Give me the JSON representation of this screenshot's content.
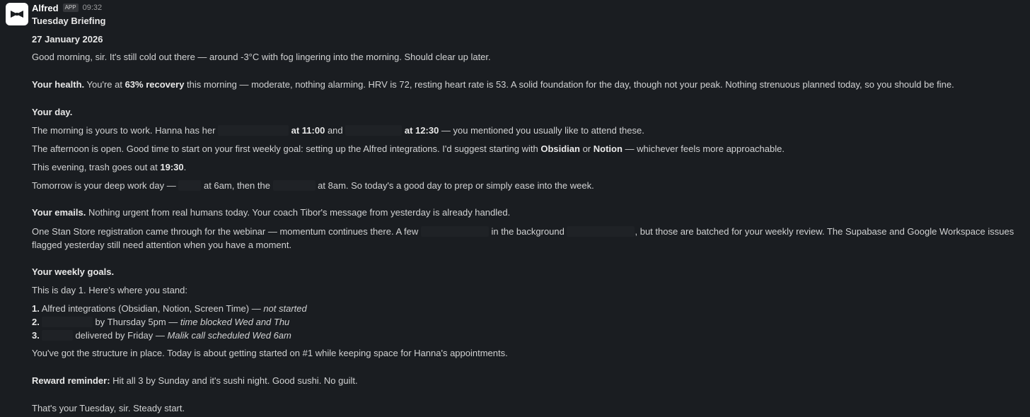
{
  "message": {
    "sender": "Alfred",
    "badge": "APP",
    "time": "09:32",
    "title": "Tuesday Briefing",
    "date": "27 January 2026",
    "greeting": "Good morning, sir. It's still cold out there — around -3°C with fog lingering into the morning. Should clear up later.",
    "health": {
      "label": "Your health.",
      "pre": " You're at ",
      "recovery": "63% recovery",
      "post": " this morning — moderate, nothing alarming. HRV is 72, resting heart rate is 53. A solid foundation for the day, though not your peak. Nothing strenuous planned today, so you should be fine."
    },
    "day": {
      "label": "Your day.",
      "l1_a": "The morning is yours to work. Hanna has her ",
      "l1_t1": " at 11:00",
      "l1_and": " and ",
      "l1_t2": " at 12:30",
      "l1_b": " — you mentioned you usually like to attend these.",
      "l2_a": "The afternoon is open. Good time to start on your first weekly goal: setting up the Alfred integrations. I'd suggest starting with ",
      "l2_obsidian": "Obsidian",
      "l2_or": " or ",
      "l2_notion": "Notion",
      "l2_b": " — whichever feels more approachable.",
      "l3_a": "This evening, trash goes out at ",
      "l3_time": "19:30",
      "l3_b": ".",
      "l4_a": "Tomorrow is your deep work day — ",
      "l4_b": " at 6am, then the ",
      "l4_c": " at 8am. So today's a good day to prep or simply ease into the week."
    },
    "emails": {
      "label": "Your emails.",
      "l1": " Nothing urgent from real humans today. Your coach Tibor's message from yesterday is already handled.",
      "l2_a": "One Stan Store registration came through for the webinar — momentum continues there. A few ",
      "l2_b": " in the background ",
      "l2_c": ", but those are batched for your weekly review. The Supabase and Google Workspace issues flagged yesterday still need attention when you have a moment."
    },
    "goals": {
      "label": "Your weekly goals.",
      "intro": "This is day 1. Here's where you stand:",
      "g1_num": "1.",
      "g1_text": " Alfred integrations (Obsidian, Notion, Screen Time) — ",
      "g1_status": "not started",
      "g2_num": "2.",
      "g2_text": " by Thursday 5pm — ",
      "g2_status": "time blocked Wed and Thu",
      "g3_num": "3.",
      "g3_text": " delivered by Friday — ",
      "g3_status": "Malik call scheduled Wed 6am",
      "summary": "You've got the structure in place. Today is about getting started on #1 while keeping space for Hanna's appointments."
    },
    "reward": {
      "label": "Reward reminder:",
      "text": " Hit all 3 by Sunday and it's sushi night. Good sushi. No guilt."
    },
    "closing": "That's your Tuesday, sir. Steady start."
  },
  "icons": {
    "avatar": "bowtie-icon"
  }
}
